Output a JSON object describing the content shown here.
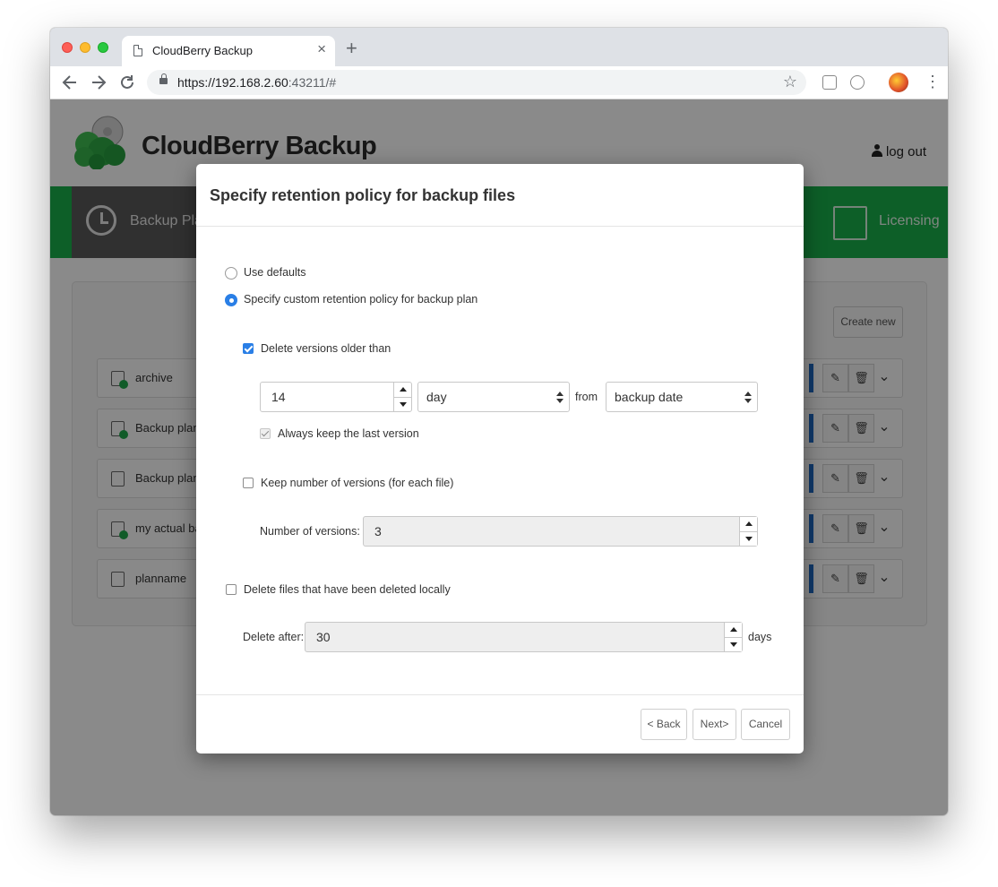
{
  "browser": {
    "tab_title": "CloudBerry Backup",
    "tab_close": "×",
    "new_tab": "+",
    "url_host": "https://192.168.2.60",
    "url_rest": ":43211/#",
    "star": "☆"
  },
  "app": {
    "brand": "CloudBerry Backup",
    "logout": "log out",
    "nav_active": "Backup Pla",
    "nav_licensing": "Licensing",
    "create_new": "Create new",
    "plans": [
      {
        "name": "archive"
      },
      {
        "name": "Backup plan"
      },
      {
        "name": "Backup plan"
      },
      {
        "name": "my actual ba"
      },
      {
        "name": "planname"
      }
    ]
  },
  "modal": {
    "title": "Specify retention policy for backup files",
    "use_defaults": "Use defaults",
    "custom_policy": "Specify custom retention policy for backup plan",
    "delete_older": "Delete versions older than",
    "age_value": "14",
    "age_unit": "day",
    "from_label": "from",
    "from_value": "backup date",
    "always_keep": "Always keep the last version",
    "keep_number": "Keep number of versions (for each file)",
    "num_versions_label": "Number of versions:",
    "num_versions_value": "3",
    "delete_local": "Delete files that have been deleted locally",
    "delete_after_label": "Delete after:",
    "delete_after_value": "30",
    "days_label": "days",
    "back": "< Back",
    "next": "Next>",
    "cancel": "Cancel"
  },
  "colors": {
    "nav_green": "#19b04b",
    "accent_blue": "#2a7fe6"
  }
}
